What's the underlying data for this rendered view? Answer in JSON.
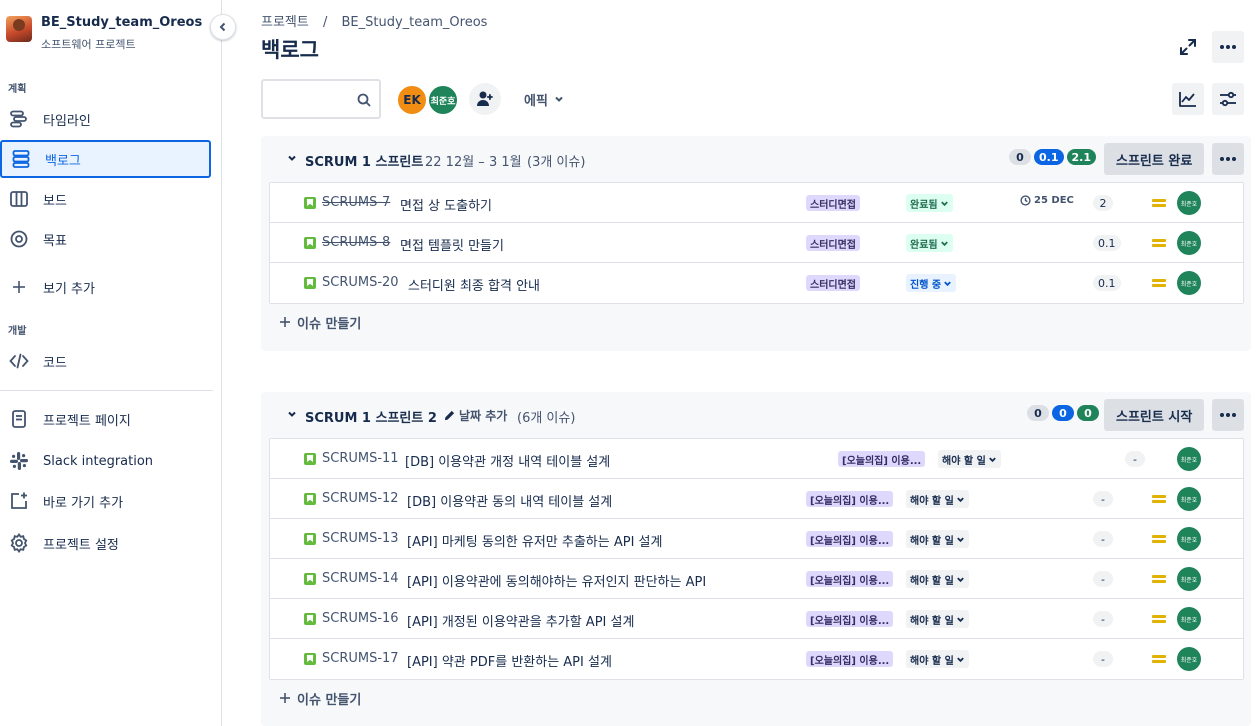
{
  "project": {
    "name": "BE_Study_team_Oreos",
    "type": "소프트웨어 프로젝트"
  },
  "sidebar": {
    "sections": {
      "planning": "계획",
      "development": "개발"
    },
    "items": [
      {
        "label": "타임라인",
        "icon": "timeline-icon"
      },
      {
        "label": "백로그",
        "icon": "backlog-icon"
      },
      {
        "label": "보드",
        "icon": "board-icon"
      },
      {
        "label": "목표",
        "icon": "goal-icon"
      },
      {
        "label": "보기 추가",
        "icon": "plus-icon"
      },
      {
        "label": "코드",
        "icon": "code-icon"
      },
      {
        "label": "프로젝트 페이지",
        "icon": "page-icon"
      },
      {
        "label": "Slack integration",
        "icon": "slack-icon"
      },
      {
        "label": "바로 가기 추가",
        "icon": "add-shortcut-icon"
      },
      {
        "label": "프로젝트 설정",
        "icon": "settings-icon"
      }
    ]
  },
  "breadcrumb": {
    "root": "프로젝트",
    "separator": "/",
    "project": "BE_Study_team_Oreos"
  },
  "page": {
    "title": "백로그"
  },
  "filters": {
    "search_placeholder": "",
    "avatars": [
      {
        "initials": "EK",
        "color": "#f18d13"
      },
      {
        "initials": "최준호",
        "color": "#1f845a"
      }
    ],
    "epic_label": "에픽"
  },
  "sprints": [
    {
      "name": "SCRUM 1 스프린트",
      "dates": "22 12월 – 3 1월",
      "issue_count": "(3개 이슈)",
      "counts": [
        "0",
        "0.1",
        "2.1"
      ],
      "button": "스프린트 완료",
      "create_label": "이슈 만들기",
      "issues": [
        {
          "key": "SCRUMS-7",
          "summary": "면접 상 도출하기",
          "epic": "스터디면접",
          "status": "완료됨",
          "due": "25 DEC",
          "points": "2",
          "assignee": "최준호"
        },
        {
          "key": "SCRUMS-8",
          "summary": "면접 템플릿 만들기",
          "epic": "스터디면접",
          "status": "완료됨",
          "due": "",
          "points": "0.1",
          "assignee": "최준호"
        },
        {
          "key": "SCRUMS-20",
          "summary": "스터디원 최종 합격 안내",
          "epic": "스터디면접",
          "status": "진행 중",
          "due": "",
          "points": "0.1",
          "assignee": "최준호"
        }
      ]
    },
    {
      "name": "SCRUM 1 스프린트 2",
      "add_date": "날짜 추가",
      "issue_count": "(6개 이슈)",
      "counts": [
        "0",
        "0",
        "0"
      ],
      "button": "스프린트 시작",
      "create_label": "이슈 만들기",
      "issues": [
        {
          "key": "SCRUMS-11",
          "summary": "[DB] 이용약관 개정 내역 테이블 설계",
          "epic": "[오늘의집] 이용...",
          "status": "해야 할 일",
          "points": "-",
          "assignee": "최준호"
        },
        {
          "key": "SCRUMS-12",
          "summary": "[DB] 이용약관 동의 내역 테이블 설계",
          "epic": "[오늘의집] 이용...",
          "status": "해야 할 일",
          "points": "-",
          "assignee": "최준호"
        },
        {
          "key": "SCRUMS-13",
          "summary": "[API] 마케팅 동의한 유저만 추출하는 API 설계",
          "epic": "[오늘의집] 이용...",
          "status": "해야 할 일",
          "points": "-",
          "assignee": "최준호"
        },
        {
          "key": "SCRUMS-14",
          "summary": "[API] 이용약관에 동의해야하는 유저인지 판단하는 API",
          "epic": "[오늘의집] 이용...",
          "status": "해야 할 일",
          "points": "-",
          "assignee": "최준호"
        },
        {
          "key": "SCRUMS-16",
          "summary": "[API] 개정된 이용약관을 추가할 API 설계",
          "epic": "[오늘의집] 이용...",
          "status": "해야 할 일",
          "points": "-",
          "assignee": "최준호"
        },
        {
          "key": "SCRUMS-17",
          "summary": "[API] 약관 PDF를 반환하는 API 설계",
          "epic": "[오늘의집] 이용...",
          "status": "해야 할 일",
          "points": "-",
          "assignee": "최준호"
        }
      ]
    }
  ]
}
